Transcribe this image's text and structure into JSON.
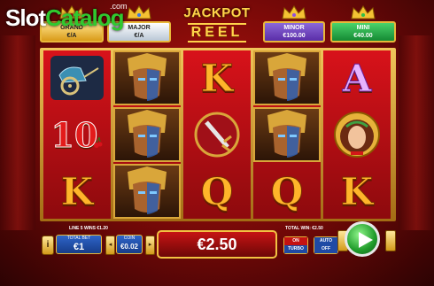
{
  "watermark": {
    "part1": "Slot",
    "part2": "Catalog",
    "suffix": ".com"
  },
  "jackpots": [
    {
      "name": "GRAND",
      "value": "€/A"
    },
    {
      "name": "MAJOR",
      "value": "€/A"
    },
    {
      "name": "MINOR",
      "value": "€100.00"
    },
    {
      "name": "MINI",
      "value": "€40.00"
    }
  ],
  "logo": {
    "line1": "JACKPOT",
    "line2": "REEL"
  },
  "reels": [
    [
      "chariot",
      "10",
      "K"
    ],
    [
      "warrior",
      "warrior",
      "warrior"
    ],
    [
      "K",
      "sword",
      "Q"
    ],
    [
      "warrior",
      "warrior",
      "Q"
    ],
    [
      "A",
      "queen",
      "K"
    ]
  ],
  "footer": {
    "lines_wins": "LINE 5 WINS €1.20",
    "total_win": "TOTAL WIN: €2.50",
    "info_glyph": "i",
    "total_bet_label": "TOTAL BET",
    "total_bet_value": "€1",
    "coin_label": "COIN",
    "coin_value": "€0.02",
    "win_amount": "€2.50",
    "turbo_top": "ON",
    "turbo_bottom": "TURBO",
    "auto_top": "AUTO",
    "auto_bottom": "OFF"
  },
  "colors": {
    "background": "#6e0807",
    "accent_gold": "#f2c242",
    "spin_green": "#1f9b2a",
    "panel_blue": "#2e64c9"
  }
}
